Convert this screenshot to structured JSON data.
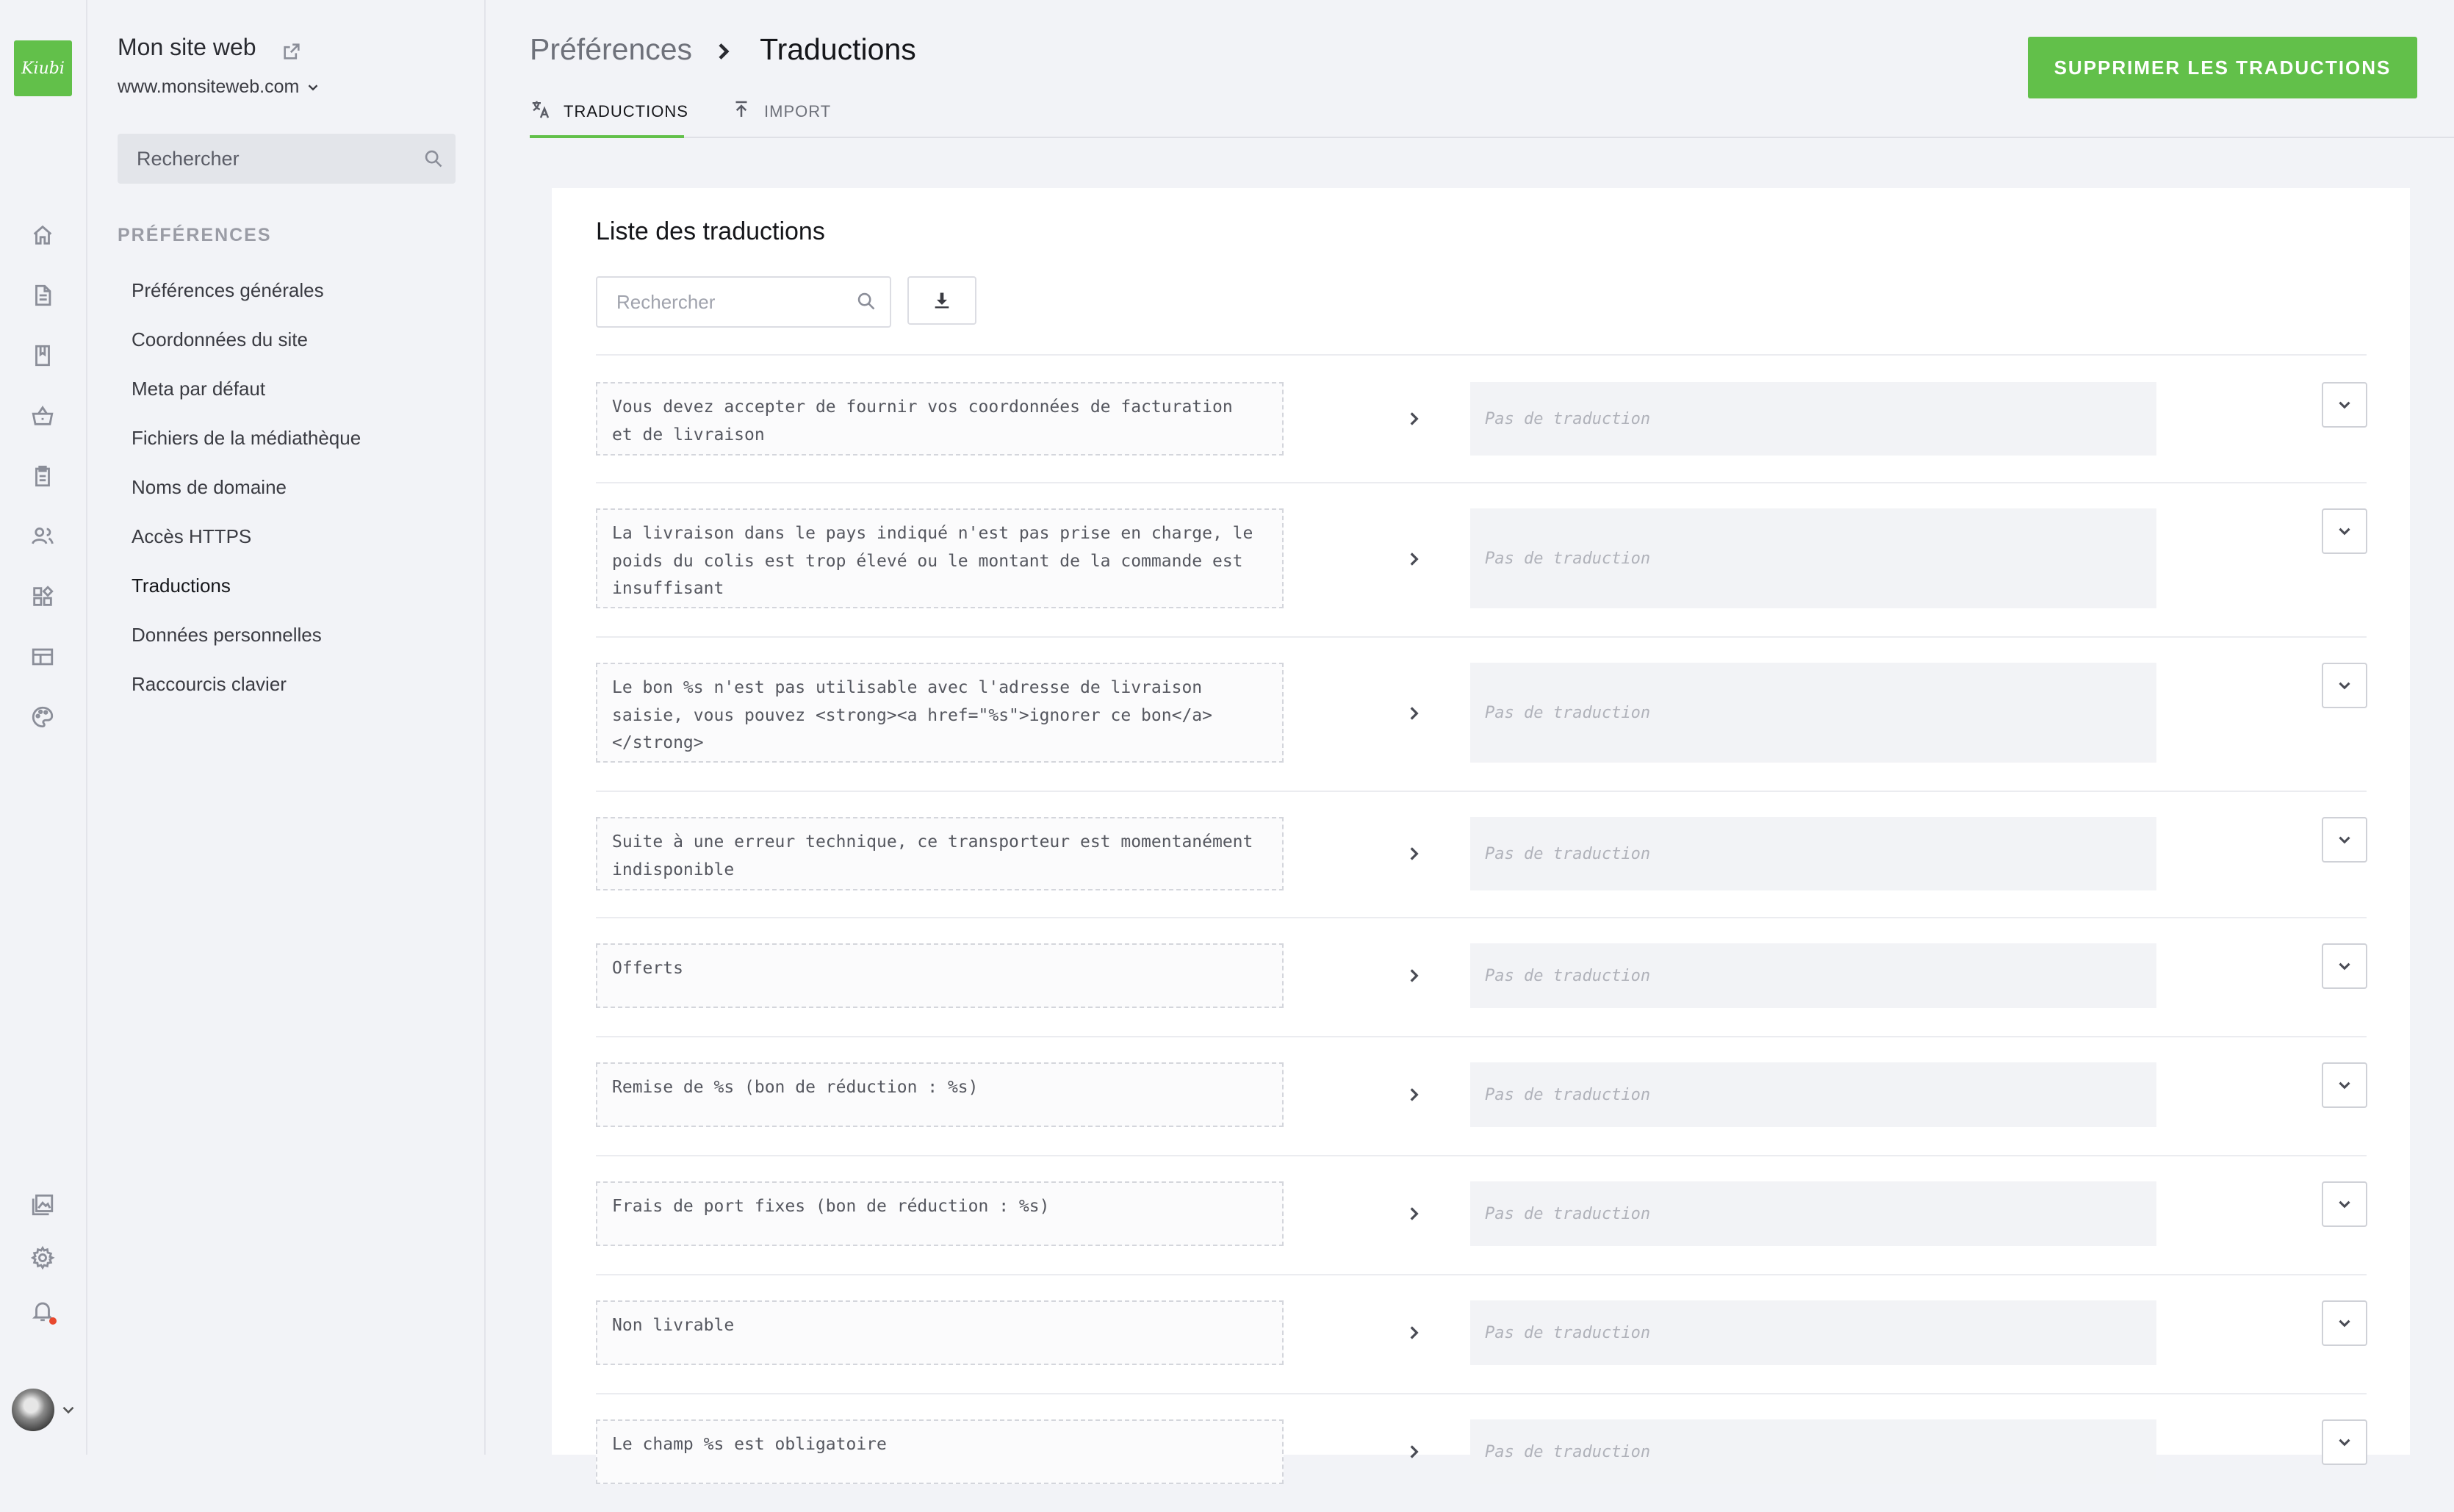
{
  "brand": {
    "logo_text": "Kiubi",
    "accent": "#62c04a"
  },
  "site": {
    "title": "Mon site web",
    "url": "www.monsiteweb.com"
  },
  "sidebar": {
    "search_placeholder": "Rechercher",
    "section": "PRÉFÉRENCES",
    "items": [
      {
        "label": "Préférences générales"
      },
      {
        "label": "Coordonnées du site"
      },
      {
        "label": "Meta par défaut"
      },
      {
        "label": "Fichiers de la médiathèque"
      },
      {
        "label": "Noms de domaine"
      },
      {
        "label": "Accès HTTPS"
      },
      {
        "label": "Traductions",
        "active": true
      },
      {
        "label": "Données personnelles"
      },
      {
        "label": "Raccourcis clavier"
      }
    ]
  },
  "rail": {
    "icons": [
      "home-icon",
      "page-icon",
      "book-icon",
      "basket-icon",
      "clipboard-icon",
      "users-icon",
      "apps-icon",
      "layout-icon",
      "palette-icon"
    ],
    "bottom_icons": [
      "media-icon",
      "gear-icon",
      "bell-icon"
    ]
  },
  "header": {
    "breadcrumb_parent": "Préférences",
    "breadcrumb_current": "Traductions",
    "delete_button": "SUPPRIMER LES TRADUCTIONS"
  },
  "tabs": [
    {
      "label": "TRADUCTIONS",
      "icon": "translate-icon",
      "active": true
    },
    {
      "label": "IMPORT",
      "icon": "upload-icon",
      "active": false
    }
  ],
  "list": {
    "title": "Liste des traductions",
    "search_placeholder": "Rechercher",
    "empty_translation": "Pas de traduction",
    "rows": [
      {
        "source": "Vous devez accepter de fournir vos coordonnées de facturation\net de livraison"
      },
      {
        "source": "La livraison dans le pays indiqué n'est pas prise en charge, le\npoids du colis est trop élevé ou le montant de la commande est\ninsuffisant"
      },
      {
        "source": "Le bon %s n'est pas utilisable avec l'adresse de livraison\nsaisie, vous pouvez <strong><a href=\"%s\">ignorer ce bon</a>\n</strong>"
      },
      {
        "source": "Suite à une erreur technique, ce transporteur est momentanément\nindisponible"
      },
      {
        "source": "Offerts"
      },
      {
        "source": "Remise de %s (bon de réduction : %s)"
      },
      {
        "source": "Frais de port fixes (bon de réduction : %s)"
      },
      {
        "source": "Non livrable"
      },
      {
        "source": "Le champ %s est obligatoire"
      }
    ]
  }
}
